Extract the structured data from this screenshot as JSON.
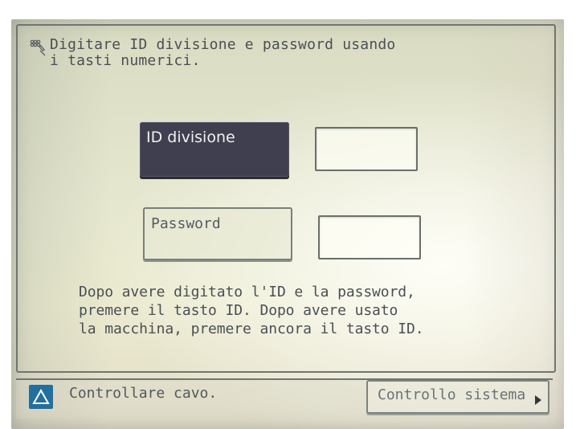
{
  "panel": {
    "prompt": "Digitare ID divisione e password usando\ni tasti numerici.",
    "fields": {
      "division_label": "ID divisione",
      "password_label": "Password",
      "division_value": "",
      "password_value": ""
    },
    "instructions": "Dopo avere digitato l'ID e la password,\npremere il tasto ID. Dopo avere usato\nla macchina, premere ancora il tasto ID."
  },
  "status": {
    "message": "Controllare cavo.",
    "button_label": "Controllo sistema",
    "icon": "warning-triangle-icon",
    "icon_color": "#236f9f"
  },
  "icons": {
    "prompt_icon": "keypad-hand-icon",
    "button_icon": "right-arrow-icon"
  }
}
